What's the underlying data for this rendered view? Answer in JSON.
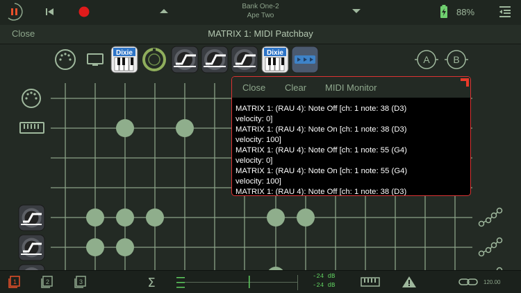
{
  "header": {
    "bank": "Bank One-2",
    "preset": "Ape Two",
    "battery_pct": "88%"
  },
  "titlebar": {
    "close_label": "Close",
    "title": "MATRIX 1:  MIDI Patchbay"
  },
  "plugins": {
    "dixie_label_1": "Dixie",
    "dixie_label_2": "Dixie",
    "port_a": "A",
    "port_b": "B"
  },
  "monitor": {
    "close_label": "Close",
    "clear_label": "Clear",
    "title": "MIDI Monitor",
    "lines": [
      "MATRIX 1: (RAU 4): Note Off [ch: 1 note: 38 (D3)",
      "velocity: 0]",
      "MATRIX 1: (RAU 4): Note On [ch: 1 note: 38 (D3)",
      "velocity: 100]",
      "MATRIX 1: (RAU 4): Note Off [ch: 1 note: 55 (G4)",
      "velocity: 0]",
      "MATRIX 1: (RAU 4): Note On [ch: 1 note: 55 (G4)",
      "velocity: 100]",
      "MATRIX 1: (RAU 4): Note Off [ch: 1 note: 38 (D3)"
    ]
  },
  "footer": {
    "db_top": "-24 dB",
    "db_bottom": "-24 dB",
    "tempo": "120.00"
  },
  "colors": {
    "accent_green": "#9fb89d",
    "record_red": "#e01b1b",
    "pause_orange": "#e8502a",
    "meter_green": "#5fce5f",
    "monitor_border": "#dd3333"
  }
}
